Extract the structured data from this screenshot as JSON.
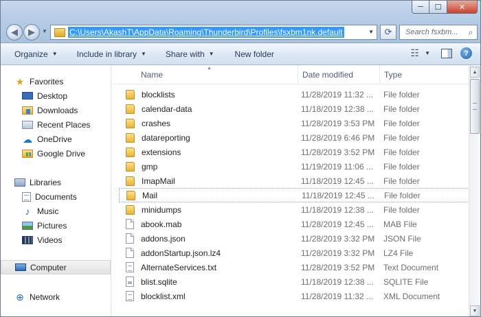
{
  "window": {
    "controls": {
      "minimize": "─",
      "maximize": "☐",
      "close": "✕"
    }
  },
  "address_bar": {
    "path": "C:\\Users\\AkashT\\AppData\\Roaming\\Thunderbird\\Profiles\\fsxbm1nk.default"
  },
  "search": {
    "placeholder": "Search fsxbm..."
  },
  "toolbar": {
    "organize": "Organize",
    "include_in_library": "Include in library",
    "share_with": "Share with",
    "new_folder": "New folder"
  },
  "nav": {
    "favorites": "Favorites",
    "desktop": "Desktop",
    "downloads": "Downloads",
    "recent_places": "Recent Places",
    "onedrive": "OneDrive",
    "google_drive": "Google Drive",
    "libraries": "Libraries",
    "documents": "Documents",
    "music": "Music",
    "pictures": "Pictures",
    "videos": "Videos",
    "computer": "Computer",
    "network": "Network"
  },
  "columns": {
    "name": "Name",
    "date_modified": "Date modified",
    "type": "Type"
  },
  "files": [
    {
      "name": "blocklists",
      "date": "11/28/2019 11:32 ...",
      "type": "File folder",
      "icon": "folder-icon"
    },
    {
      "name": "calendar-data",
      "date": "11/18/2019 12:38 ...",
      "type": "File folder",
      "icon": "folder-icon"
    },
    {
      "name": "crashes",
      "date": "11/28/2019 3:53 PM",
      "type": "File folder",
      "icon": "folder-icon"
    },
    {
      "name": "datareporting",
      "date": "11/28/2019 6:46 PM",
      "type": "File folder",
      "icon": "folder-icon"
    },
    {
      "name": "extensions",
      "date": "11/28/2019 3:52 PM",
      "type": "File folder",
      "icon": "folder-icon"
    },
    {
      "name": "gmp",
      "date": "11/19/2019 11:06 ...",
      "type": "File folder",
      "icon": "folder-icon"
    },
    {
      "name": "ImapMail",
      "date": "11/18/2019 12:45 ...",
      "type": "File folder",
      "icon": "folder-icon"
    },
    {
      "name": "Mail",
      "date": "11/18/2019 12:45 ...",
      "type": "File folder",
      "icon": "folder-icon"
    },
    {
      "name": "minidumps",
      "date": "11/18/2019 12:38 ...",
      "type": "File folder",
      "icon": "folder-icon"
    },
    {
      "name": "abook.mab",
      "date": "11/28/2019 12:45 ...",
      "type": "MAB File",
      "icon": "file-icon"
    },
    {
      "name": "addons.json",
      "date": "11/28/2019 3:32 PM",
      "type": "JSON File",
      "icon": "file-icon"
    },
    {
      "name": "addonStartup.json.lz4",
      "date": "11/28/2019 3:32 PM",
      "type": "LZ4 File",
      "icon": "file-icon"
    },
    {
      "name": "AlternateServices.txt",
      "date": "11/28/2019 3:52 PM",
      "type": "Text Document",
      "icon": "text-file-icon"
    },
    {
      "name": "blist.sqlite",
      "date": "11/18/2019 12:38 ...",
      "type": "SQLITE File",
      "icon": "sqlite-file-icon"
    },
    {
      "name": "blocklist.xml",
      "date": "11/28/2019 11:32 ...",
      "type": "XML Document",
      "icon": "text-file-icon"
    }
  ],
  "highlighted_file": "Mail"
}
